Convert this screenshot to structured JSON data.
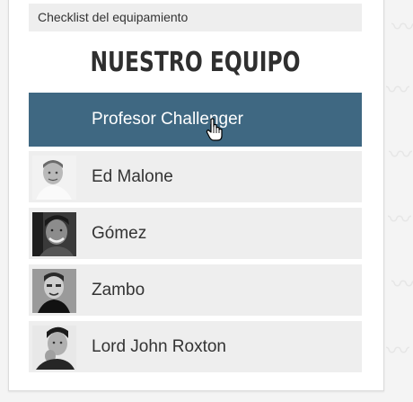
{
  "checklist": {
    "label": "Checklist del equipamiento"
  },
  "team": {
    "title": "NUESTRO EQUIPO",
    "members": [
      {
        "name": "Profesor Challenger",
        "active": true,
        "avatar_icon": "none"
      },
      {
        "name": "Ed Malone",
        "active": false,
        "avatar_icon": "person-photo-smiling"
      },
      {
        "name": "Gómez",
        "active": false,
        "avatar_icon": "person-photo-laughing"
      },
      {
        "name": "Zambo",
        "active": false,
        "avatar_icon": "person-photo-grayscale"
      },
      {
        "name": "Lord John Roxton",
        "active": false,
        "avatar_icon": "person-photo-thinking"
      }
    ]
  },
  "colors": {
    "active_row": "#3f6882",
    "row_bg": "#eeeeee",
    "page_bg": "#f4f4f4"
  }
}
